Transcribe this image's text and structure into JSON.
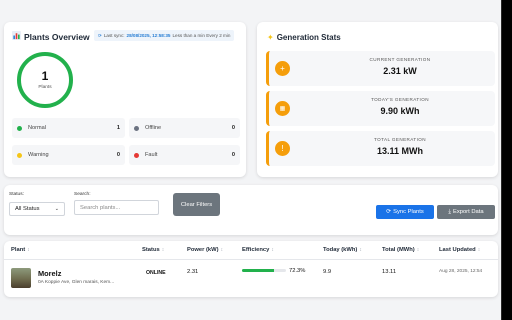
{
  "overview": {
    "title": "Plants Overview",
    "title_icon": "chart-icon",
    "last_sync_label": "Last sync:",
    "last_sync_time": "28/08/2025, 12:58:35",
    "last_sync_ago": "Less than a min Every 2 min",
    "total_count": "1",
    "total_label": "Plants",
    "ring_color": "#22b14c",
    "statuses": [
      {
        "label": "Normal",
        "count": "1",
        "color": "#22b14c"
      },
      {
        "label": "Offline",
        "count": "0",
        "color": "#6b7280"
      },
      {
        "label": "Warning",
        "count": "0",
        "color": "#f5c518"
      },
      {
        "label": "Fault",
        "count": "0",
        "color": "#e53935"
      }
    ]
  },
  "generation": {
    "title": "Generation Stats",
    "title_icon": "sparkle-icon",
    "accent": "#f59e0b",
    "items": [
      {
        "label": "CURRENT GENERATION",
        "value": "2.31 kW",
        "icon": "plus-icon",
        "glyph": "+"
      },
      {
        "label": "TODAY'S GENERATION",
        "value": "9.90 kWh",
        "icon": "calendar-icon",
        "glyph": "▦"
      },
      {
        "label": "TOTAL GENERATION",
        "value": "13.11 MWh",
        "icon": "exclamation-icon",
        "glyph": "!"
      }
    ]
  },
  "filters": {
    "status_label": "Status:",
    "status_value": "All Status",
    "search_label": "Search:",
    "search_placeholder": "Search plants...",
    "clear_label": "Clear Filters",
    "sync_label": "Sync Plants",
    "export_label": "Export Data"
  },
  "table": {
    "columns": [
      "Plant",
      "Status",
      "Power (kW)",
      "Efficiency",
      "Today (kWh)",
      "Total (MWh)",
      "Last Updated"
    ],
    "sort_glyph": "↕",
    "rows": [
      {
        "name": "Morelz",
        "address": "0A Koppie Ave, Glen marais, Kem...",
        "status": "ONLINE",
        "power": "2.31",
        "efficiency": "72.3%",
        "efficiency_pct": 72.3,
        "today": "9.9",
        "total": "13.11",
        "updated": "Aug 28, 2025, 12:54"
      }
    ]
  }
}
